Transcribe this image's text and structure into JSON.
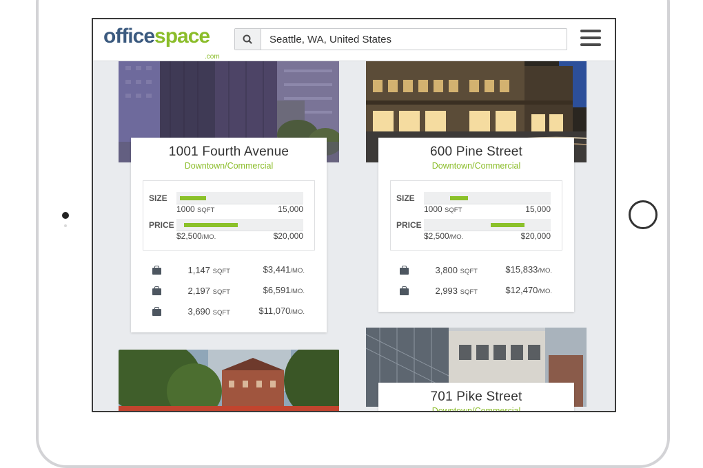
{
  "header": {
    "logo": {
      "office": "office",
      "space": "space",
      "com": ".com"
    },
    "search": {
      "icon": "search-icon",
      "value": "Seattle, WA, United States"
    },
    "menu_icon": "hamburger-menu-icon"
  },
  "colors": {
    "brand_blue": "#3b5a7f",
    "brand_green": "#8bbd2a",
    "bar_green": "#8bc12a"
  },
  "listings": [
    {
      "name": "1001 Fourth Avenue",
      "area": "Downtown/Commercial",
      "size": {
        "label": "SIZE",
        "min": "1000",
        "min_unit": "SQFT",
        "max": "15,000"
      },
      "price": {
        "label": "PRICE",
        "min": "$2,500",
        "min_unit": "/MO.",
        "max": "$20,000"
      },
      "spaces": [
        {
          "sqft": "1,147",
          "sqft_unit": "SQFT",
          "price": "$3,441",
          "price_unit": "/MO."
        },
        {
          "sqft": "2,197",
          "sqft_unit": "SQFT",
          "price": "$6,591",
          "price_unit": "/MO."
        },
        {
          "sqft": "3,690",
          "sqft_unit": "SQFT",
          "price": "$11,070",
          "price_unit": "/MO."
        }
      ]
    },
    {
      "name": "600 Pine Street",
      "area": "Downtown/Commercial",
      "size": {
        "label": "SIZE",
        "min": "1000",
        "min_unit": "SQFT",
        "max": "15,000"
      },
      "price": {
        "label": "PRICE",
        "min": "$2,500",
        "min_unit": "/MO.",
        "max": "$20,000"
      },
      "spaces": [
        {
          "sqft": "3,800",
          "sqft_unit": "SQFT",
          "price": "$15,833",
          "price_unit": "/MO."
        },
        {
          "sqft": "2,993",
          "sqft_unit": "SQFT",
          "price": "$12,470",
          "price_unit": "/MO."
        }
      ]
    },
    {
      "name": "701 Pike Street",
      "area": "Downtown/Commercial"
    }
  ]
}
